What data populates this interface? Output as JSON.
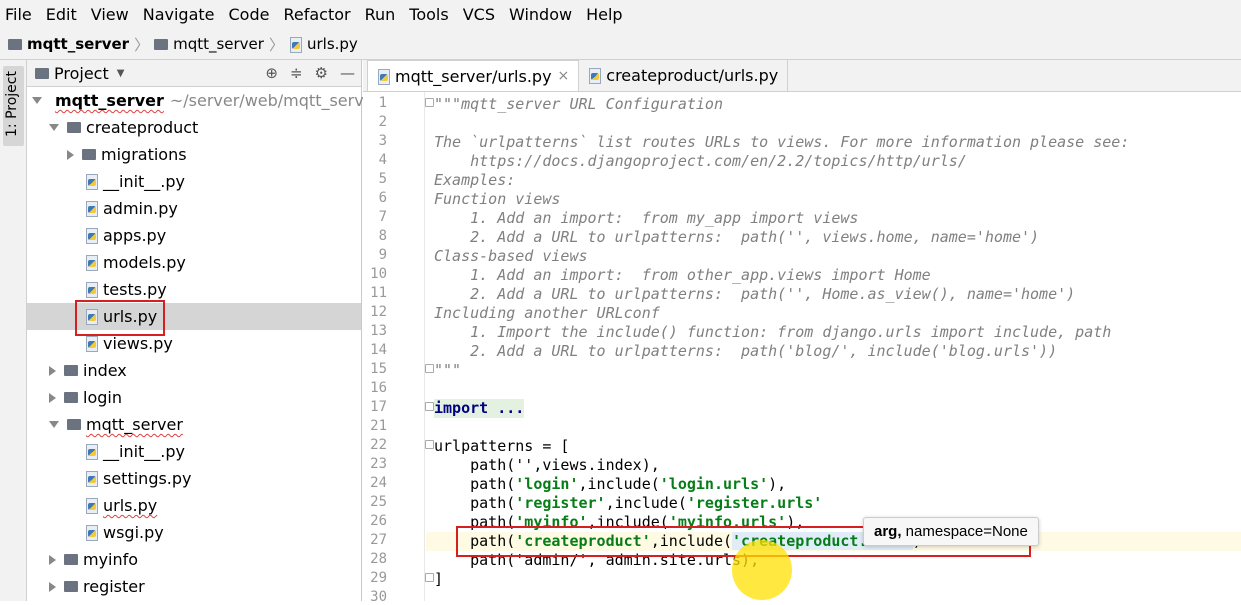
{
  "menu": [
    "File",
    "Edit",
    "View",
    "Navigate",
    "Code",
    "Refactor",
    "Run",
    "Tools",
    "VCS",
    "Window",
    "Help"
  ],
  "breadcrumb": [
    "mqtt_server",
    "mqtt_server",
    "urls.py"
  ],
  "sidebar_tab": "1: Project",
  "project_panel": {
    "title": "Project"
  },
  "tree": {
    "root": "mqtt_server",
    "root_path": "~/server/web/mqtt_server",
    "items": [
      "createproduct",
      "migrations",
      "__init__.py",
      "admin.py",
      "apps.py",
      "models.py",
      "tests.py",
      "urls.py",
      "views.py",
      "index",
      "login",
      "mqtt_server",
      "__init__.py",
      "settings.py",
      "urls.py",
      "wsgi.py",
      "myinfo",
      "register"
    ]
  },
  "tabs": [
    "mqtt_server/urls.py",
    "createproduct/urls.py"
  ],
  "code": {
    "line_numbers": [
      "1",
      "2",
      "3",
      "4",
      "5",
      "6",
      "7",
      "8",
      "9",
      "10",
      "11",
      "12",
      "13",
      "14",
      "15",
      "16",
      "17",
      "21",
      "22",
      "23",
      "24",
      "25",
      "26",
      "27",
      "28",
      "29",
      "30"
    ],
    "l1": "\"\"\"mqtt_server URL Configuration",
    "l3": "The `urlpatterns` list routes URLs to views. For more information please see:",
    "l4": "    https://docs.djangoproject.com/en/2.2/topics/http/urls/",
    "l5": "Examples:",
    "l6": "Function views",
    "l7": "    1. Add an import:  from my_app import views",
    "l8": "    2. Add a URL to urlpatterns:  path('', views.home, name='home')",
    "l9": "Class-based views",
    "l10": "    1. Add an import:  from other_app.views import Home",
    "l11": "    2. Add a URL to urlpatterns:  path('', Home.as_view(), name='home')",
    "l12": "Including another URLconf",
    "l13": "    1. Import the include() function: from django.urls import include, path",
    "l14": "    2. Add a URL to urlpatterns:  path('blog/', include('blog.urls'))",
    "l15": "\"\"\"",
    "l17": "import ...",
    "l22": "urlpatterns = [",
    "l23": "    path('',views.index),",
    "l24a": "    path(",
    "l24s": "'login.urls'",
    "l24b": "include(",
    "l24q": "'login'",
    "l24c": "),",
    "l25q": "'register'",
    "l25s": "'register.urls'",
    "l26q": "'myinfo'",
    "l26s": "'myinfo.urls'",
    "l27q": "'createproduct'",
    "l27s": "'createproduct.urls'",
    "l28": "    path('admin/', admin.site.urls),",
    "l29": "]"
  },
  "tooltip": {
    "bold": "arg,",
    "rest": " namespace=None"
  }
}
